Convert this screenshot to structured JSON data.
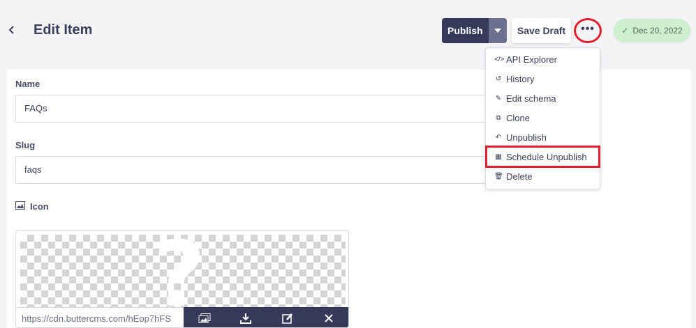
{
  "header": {
    "title": "Edit Item",
    "publish_label": "Publish",
    "save_draft_label": "Save Draft",
    "more_label": "•••",
    "date_badge": "Dec 20, 2022"
  },
  "menu": {
    "items": [
      {
        "label": "API Explorer",
        "icon": "code-icon"
      },
      {
        "label": "History",
        "icon": "history-icon"
      },
      {
        "label": "Edit schema",
        "icon": "pencil-icon"
      },
      {
        "label": "Clone",
        "icon": "clone-icon"
      },
      {
        "label": "Unpublish",
        "icon": "undo-icon"
      },
      {
        "label": "Schedule Unpublish",
        "icon": "calendar-icon"
      },
      {
        "label": "Delete",
        "icon": "trash-icon"
      }
    ]
  },
  "form": {
    "name_label": "Name",
    "name_value": "FAQs",
    "slug_label": "Slug",
    "slug_value": "faqs",
    "icon_label": "Icon",
    "icon_url": "https://cdn.buttercms.com/hEop7hFS"
  },
  "colors": {
    "primary": "#36395a",
    "highlight": "#e01e2e",
    "badge_bg": "#cdeecf"
  }
}
